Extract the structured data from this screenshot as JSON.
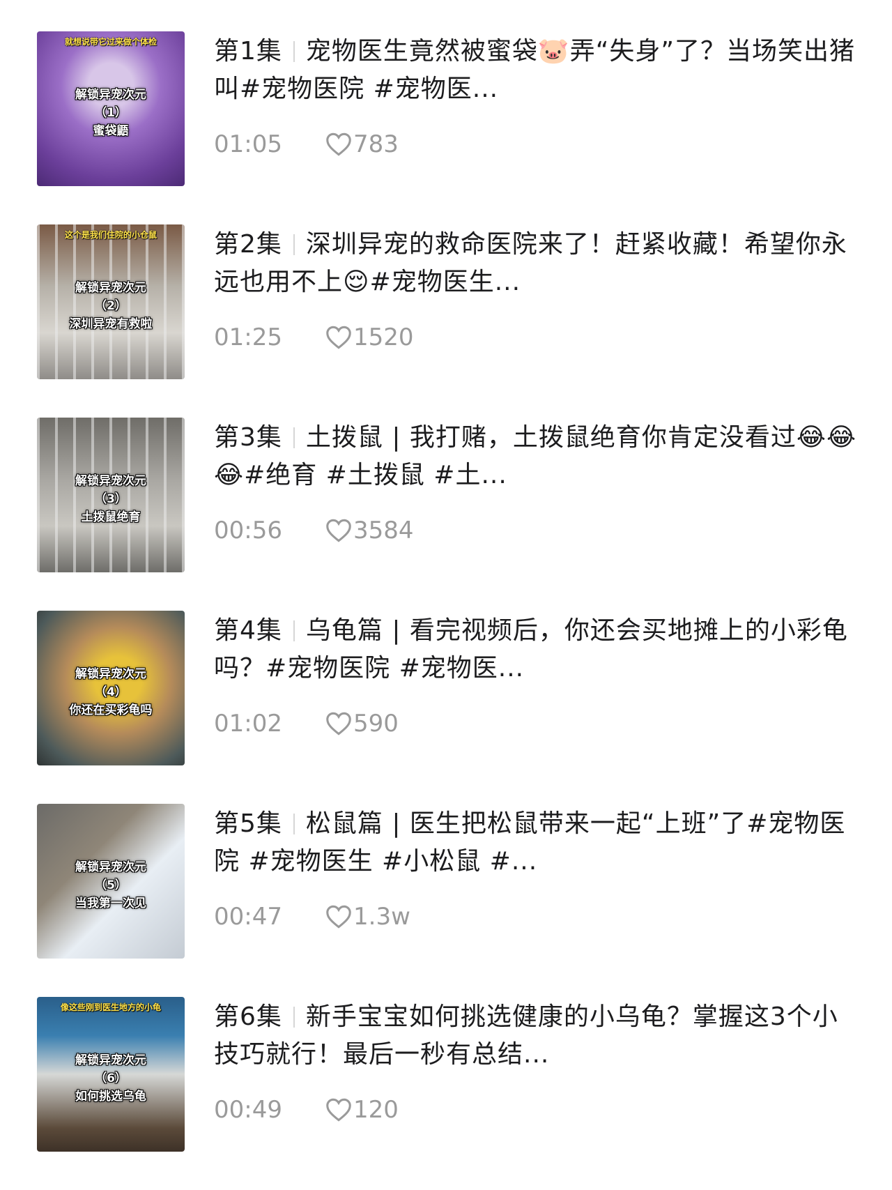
{
  "colors": {
    "title_text": "#1c1c1e",
    "meta_text": "#9a9a9a",
    "separator": "#d6d6d6",
    "thumb_caption": "#ffffff",
    "thumb_banner": "#ffe24a"
  },
  "episodes": [
    {
      "episode": "第1集",
      "title": "宠物医生竟然被蜜袋🐷弄“失身”了？当场笑出猪叫#宠物医院 #宠物医...",
      "duration": "01:05",
      "likes": "783",
      "thumb": {
        "banner": "就想说带它过来做个体检",
        "line1": "解锁异宠次元",
        "line2": "（1）",
        "line3": "蜜袋鼯"
      }
    },
    {
      "episode": "第2集",
      "title": "深圳异宠的救命医院来了！赶紧收藏！希望你永远也用不上😌#宠物医生...",
      "duration": "01:25",
      "likes": "1520",
      "thumb": {
        "banner": "这个是我们住院的小仓鼠",
        "line1": "解锁异宠次元",
        "line2": "（2）",
        "line3": "深圳异宠有救啦"
      }
    },
    {
      "episode": "第3集",
      "title": "土拨鼠 | 我打赌，土拨鼠绝育你肯定没看过😂😂😂#绝育 #土拨鼠 #土...",
      "duration": "00:56",
      "likes": "3584",
      "thumb": {
        "banner": "",
        "line1": "解锁异宠次元",
        "line2": "（3）",
        "line3": "土拨鼠绝育"
      }
    },
    {
      "episode": "第4集",
      "title": "乌龟篇 | 看完视频后，你还会买地摊上的小彩龟吗？#宠物医院 #宠物医...",
      "duration": "01:02",
      "likes": "590",
      "thumb": {
        "banner": "",
        "line1": "解锁异宠次元",
        "line2": "（4）",
        "line3": "你还在买彩龟吗"
      }
    },
    {
      "episode": "第5集",
      "title": "松鼠篇 | 医生把松鼠带来一起“上班”了#宠物医院 #宠物医生 #小松鼠 #...",
      "duration": "00:47",
      "likes": "1.3w",
      "thumb": {
        "banner": "",
        "line1": "解锁异宠次元",
        "line2": "（5）",
        "line3": "当我第一次见"
      }
    },
    {
      "episode": "第6集",
      "title": "新手宝宝如何挑选健康的小乌龟？掌握这3个小技巧就行！最后一秒有总结...",
      "duration": "00:49",
      "likes": "120",
      "thumb": {
        "banner": "像这些刚到医生地方的小龟",
        "line1": "解锁异宠次元",
        "line2": "（6）",
        "line3": "如何挑选乌龟"
      }
    }
  ]
}
